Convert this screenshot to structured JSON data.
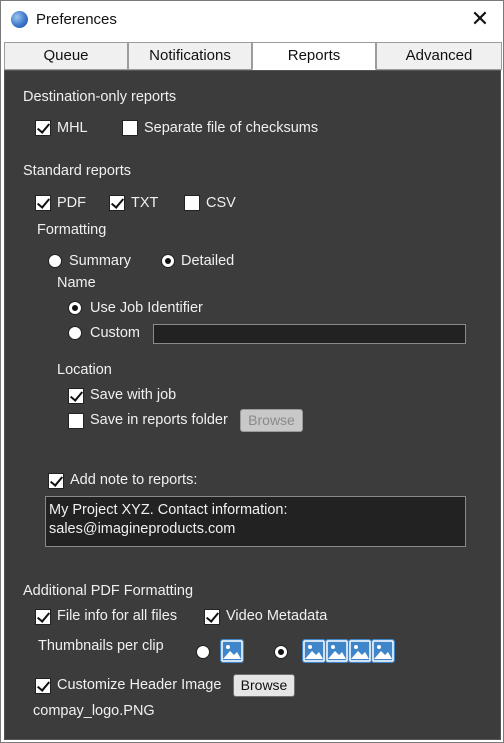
{
  "window": {
    "title": "Preferences",
    "close_glyph": "✕",
    "icon": "app-circle-icon"
  },
  "tabs": [
    {
      "label": "Queue",
      "active": false
    },
    {
      "label": "Notifications",
      "active": false
    },
    {
      "label": "Reports",
      "active": true
    },
    {
      "label": "Advanced",
      "active": false
    }
  ],
  "destination_only": {
    "heading": "Destination-only reports",
    "mhl": {
      "label": "MHL",
      "checked": true
    },
    "separate_checksums": {
      "label": "Separate file of checksums",
      "checked": false
    }
  },
  "standard": {
    "heading": "Standard reports",
    "pdf": {
      "label": "PDF",
      "checked": true
    },
    "txt": {
      "label": "TXT",
      "checked": true
    },
    "csv": {
      "label": "CSV",
      "checked": false
    },
    "formatting": {
      "heading": "Formatting",
      "summary": {
        "label": "Summary",
        "selected": false
      },
      "detailed": {
        "label": "Detailed",
        "selected": true
      }
    },
    "name": {
      "heading": "Name",
      "use_job_identifier": {
        "label": "Use Job Identifier",
        "selected": true
      },
      "custom": {
        "label": "Custom",
        "selected": false,
        "value": ""
      }
    },
    "location": {
      "heading": "Location",
      "save_with_job": {
        "label": "Save with job",
        "checked": true
      },
      "save_in_reports_folder": {
        "label": "Save in reports folder",
        "checked": false
      },
      "browse_label": "Browse"
    },
    "note": {
      "label": "Add note to reports:",
      "checked": true,
      "value": "My Project XYZ. Contact information:\nsales@imagineproducts.com"
    }
  },
  "additional_pdf": {
    "heading": "Additional PDF Formatting",
    "file_info": {
      "label": "File info for all files",
      "checked": true
    },
    "video_metadata": {
      "label": "Video Metadata",
      "checked": true
    },
    "thumbnails": {
      "label": "Thumbnails per clip",
      "one_selected": false,
      "four_selected": true
    },
    "custom_header": {
      "label": "Customize Header Image",
      "checked": true
    },
    "browse_label": "Browse",
    "header_filename": "compay_logo.PNG"
  },
  "colors": {
    "panel": "#3c3c3c",
    "field": "#222222",
    "thumb": "#3e86c9",
    "text": "#f0f0f0"
  }
}
